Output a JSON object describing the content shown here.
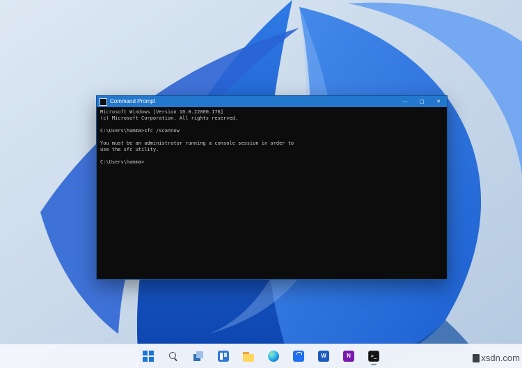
{
  "window": {
    "title": "Command Prompt",
    "controls": {
      "minimize": "—",
      "maximize": "□",
      "close": "✕"
    },
    "terminal_lines": [
      "Microsoft Windows [Version 10.0.22000.176]",
      "(c) Microsoft Corporation. All rights reserved.",
      "",
      "C:\\Users\\hamma>sfc /scannow",
      "",
      "You must be an administrator running a console session in order to",
      "use the sfc utility.",
      "",
      "C:\\Users\\hamma>"
    ]
  },
  "taskbar": {
    "items": [
      {
        "id": "start",
        "label": "Start"
      },
      {
        "id": "search",
        "label": "Search"
      },
      {
        "id": "task-view",
        "label": "Task View"
      },
      {
        "id": "widgets",
        "label": "Widgets"
      },
      {
        "id": "file-explorer",
        "label": "File Explorer"
      },
      {
        "id": "edge",
        "label": "Microsoft Edge"
      },
      {
        "id": "store",
        "label": "Microsoft Store"
      },
      {
        "id": "word",
        "label": "Word",
        "glyph_text": "W",
        "color": "#185abd"
      },
      {
        "id": "onenote",
        "label": "OneNote",
        "glyph_text": "N",
        "color": "#7719aa"
      },
      {
        "id": "command-prompt",
        "label": "Command Prompt",
        "glyph_text": ">_",
        "color": "#141414",
        "active": true
      }
    ]
  },
  "watermark": "xsdn.com",
  "colors": {
    "titlebar": "#2377cc",
    "terminal_bg": "#0c0c0c",
    "terminal_text": "#cccccc",
    "taskbar_bg": "#f2f6fb",
    "accent": "#1b74d9",
    "wallpaper_base": "#c6d6e8",
    "bloom_dark": "#0c43ad",
    "bloom_mid": "#2f7ae6",
    "bloom_light": "#79aef3"
  }
}
